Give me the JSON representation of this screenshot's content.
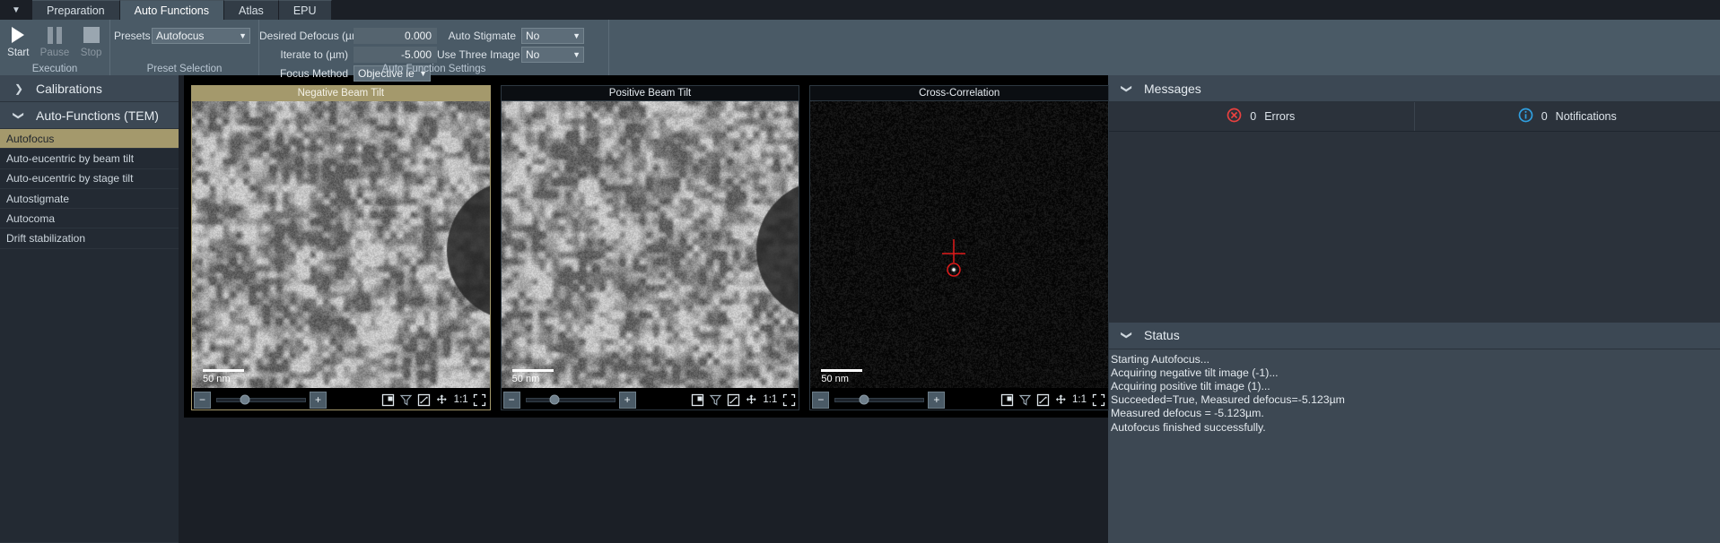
{
  "tabs": [
    {
      "label": "Preparation",
      "active": false
    },
    {
      "label": "Auto Functions",
      "active": true
    },
    {
      "label": "Atlas",
      "active": false
    },
    {
      "label": "EPU",
      "active": false
    }
  ],
  "ribbon": {
    "execution": {
      "caption": "Execution",
      "buttons": [
        {
          "label": "Start",
          "icon": "play-icon",
          "enabled": true
        },
        {
          "label": "Pause",
          "icon": "pause-icon",
          "enabled": false
        },
        {
          "label": "Stop",
          "icon": "stop-icon",
          "enabled": false
        }
      ]
    },
    "preset_selection": {
      "caption": "Preset Selection",
      "presets_label": "Presets",
      "presets_value": "Autofocus"
    },
    "auto_function_settings": {
      "caption": "Auto Function Settings",
      "fields": [
        {
          "label": "Desired Defocus (µm)",
          "value": "0.000",
          "type": "number"
        },
        {
          "label": "Iterate to (µm)",
          "value": "-5.000",
          "type": "number"
        },
        {
          "label": "Focus Method",
          "value": "Objective lens",
          "type": "combo"
        },
        {
          "label": "Auto Stigmate",
          "value": "No",
          "type": "combo"
        },
        {
          "label": "Use Three Image Method",
          "value": "No",
          "type": "combo"
        }
      ]
    }
  },
  "sidebar": {
    "groups": [
      {
        "title": "Calibrations",
        "expanded": false,
        "twisty": "chevron-right-icon",
        "items": []
      },
      {
        "title": "Auto-Functions (TEM)",
        "expanded": true,
        "twisty": "chevron-down-icon",
        "items": [
          {
            "label": "Autofocus",
            "selected": true
          },
          {
            "label": "Auto-eucentric by beam tilt",
            "selected": false
          },
          {
            "label": "Auto-eucentric by stage tilt",
            "selected": false
          },
          {
            "label": "Autostigmate",
            "selected": false
          },
          {
            "label": "Autocoma",
            "selected": false
          },
          {
            "label": "Drift stabilization",
            "selected": false
          }
        ]
      }
    ]
  },
  "viewer": {
    "panels": [
      {
        "title": "Negative Beam Tilt",
        "active": true,
        "scalebar": "50 nm",
        "toolbar": {
          "minus": "−",
          "plus": "+",
          "zoom_ratio": "1:1",
          "icons": [
            "quadrant-view-icon",
            "filter-icon",
            "fit-to-window-icon",
            "pan-icon",
            "fullscreen-icon"
          ]
        },
        "image_kind": "tem-micrograph"
      },
      {
        "title": "Positive Beam Tilt",
        "active": false,
        "scalebar": "50 nm",
        "toolbar": {
          "minus": "−",
          "plus": "+",
          "zoom_ratio": "1:1",
          "icons": [
            "quadrant-view-icon",
            "filter-icon",
            "fit-to-window-icon",
            "pan-icon",
            "fullscreen-icon"
          ]
        },
        "image_kind": "tem-micrograph"
      },
      {
        "title": "Cross-Correlation",
        "active": false,
        "scalebar": "50 nm",
        "toolbar": {
          "minus": "−",
          "plus": "+",
          "zoom_ratio": "1:1",
          "icons": [
            "quadrant-view-icon",
            "filter-icon",
            "fit-to-window-icon",
            "pan-icon",
            "fullscreen-icon"
          ]
        },
        "image_kind": "cross-correlation",
        "marker_color": "#e01b1b"
      }
    ]
  },
  "messages": {
    "title": "Messages",
    "twisty": "chevron-down-icon",
    "errors": {
      "count": "0",
      "label": "Errors",
      "icon": "error-icon",
      "color": "#e8413f"
    },
    "notifications": {
      "count": "0",
      "label": "Notifications",
      "icon": "info-icon",
      "color": "#2f9fe0"
    }
  },
  "status": {
    "title": "Status",
    "twisty": "chevron-down-icon",
    "lines": [
      "Starting Autofocus...",
      "Acquiring negative tilt image (-1)...",
      "Acquiring positive tilt image (1)...",
      "Succeeded=True, Measured defocus=-5.123µm",
      "Measured defocus = -5.123µm.",
      "Autofocus finished successfully."
    ]
  }
}
